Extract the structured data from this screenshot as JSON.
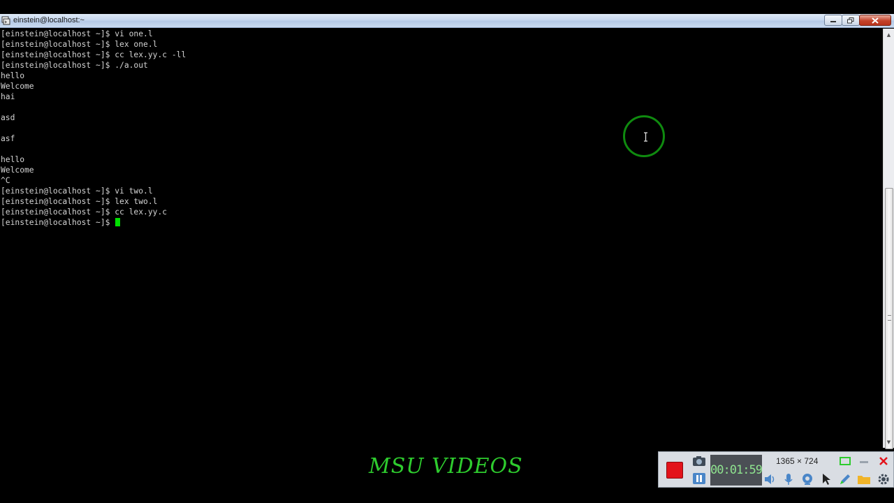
{
  "window": {
    "title": "einstein@localhost:~"
  },
  "terminal": {
    "lines": [
      "[einstein@localhost ~]$ vi one.l",
      "[einstein@localhost ~]$ lex one.l",
      "[einstein@localhost ~]$ cc lex.yy.c -ll",
      "[einstein@localhost ~]$ ./a.out",
      "hello",
      "Welcome",
      "hai",
      "",
      "asd",
      "",
      "asf",
      "",
      "hello",
      "Welcome",
      "^C",
      "[einstein@localhost ~]$ vi two.l",
      "[einstein@localhost ~]$ lex two.l",
      "[einstein@localhost ~]$ cc lex.yy.c",
      "[einstein@localhost ~]$ "
    ],
    "text_color": "#d4d4d4",
    "cursor_color": "#00e000"
  },
  "watermark": {
    "text": "MSU VIDEOS",
    "color": "#2ecc2e"
  },
  "recorder": {
    "timer": "00:01:59",
    "resolution": "1365 × 724",
    "icons": [
      "stop-icon",
      "camera-icon",
      "pause-icon",
      "speaker-icon",
      "microphone-icon",
      "webcam-icon",
      "pointer-icon",
      "pen-icon",
      "folder-icon",
      "gear-icon",
      "region-icon",
      "minimize-icon",
      "close-icon"
    ]
  }
}
